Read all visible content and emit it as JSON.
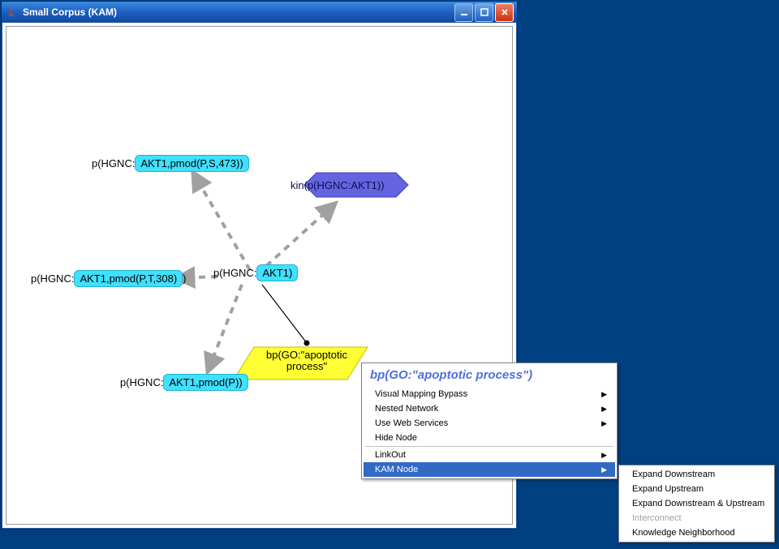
{
  "window": {
    "title": "Small Corpus (KAM)"
  },
  "nodes": {
    "n1_prefix": "p(HGNC:",
    "n1_box": "AKT1,pmod(P,S,473))",
    "n2_prefix": "p(HGNC:",
    "n2_box": "AKT1,pmod(P,T,308)",
    "n2_suffix": ")",
    "n3_prefix": "p(HGNC:",
    "n3_box": "AKT1)",
    "n4_prefix": "kin(p(",
    "n4_box": "HGNC:AKT1)",
    "n4_suffix": ")",
    "n5_prefix": "p(HGNC:",
    "n5_box": "AKT1,pmod(P))",
    "n6_line1": "bp(GO:\"apoptotic",
    "n6_line2": "process\""
  },
  "context": {
    "title": "bp(GO:\"apoptotic process\")",
    "items": {
      "m1": "Visual Mapping Bypass",
      "m2": "Nested Network",
      "m3": "Use Web Services",
      "m4": "Hide Node",
      "m5": "LinkOut",
      "m6": "KAM Node"
    },
    "submenu": {
      "s1": "Expand Downstream",
      "s2": "Expand Upstream",
      "s3": "Expand Downstream & Upstream",
      "s4": "Interconnect",
      "s5": "Knowledge Neighborhood"
    }
  }
}
